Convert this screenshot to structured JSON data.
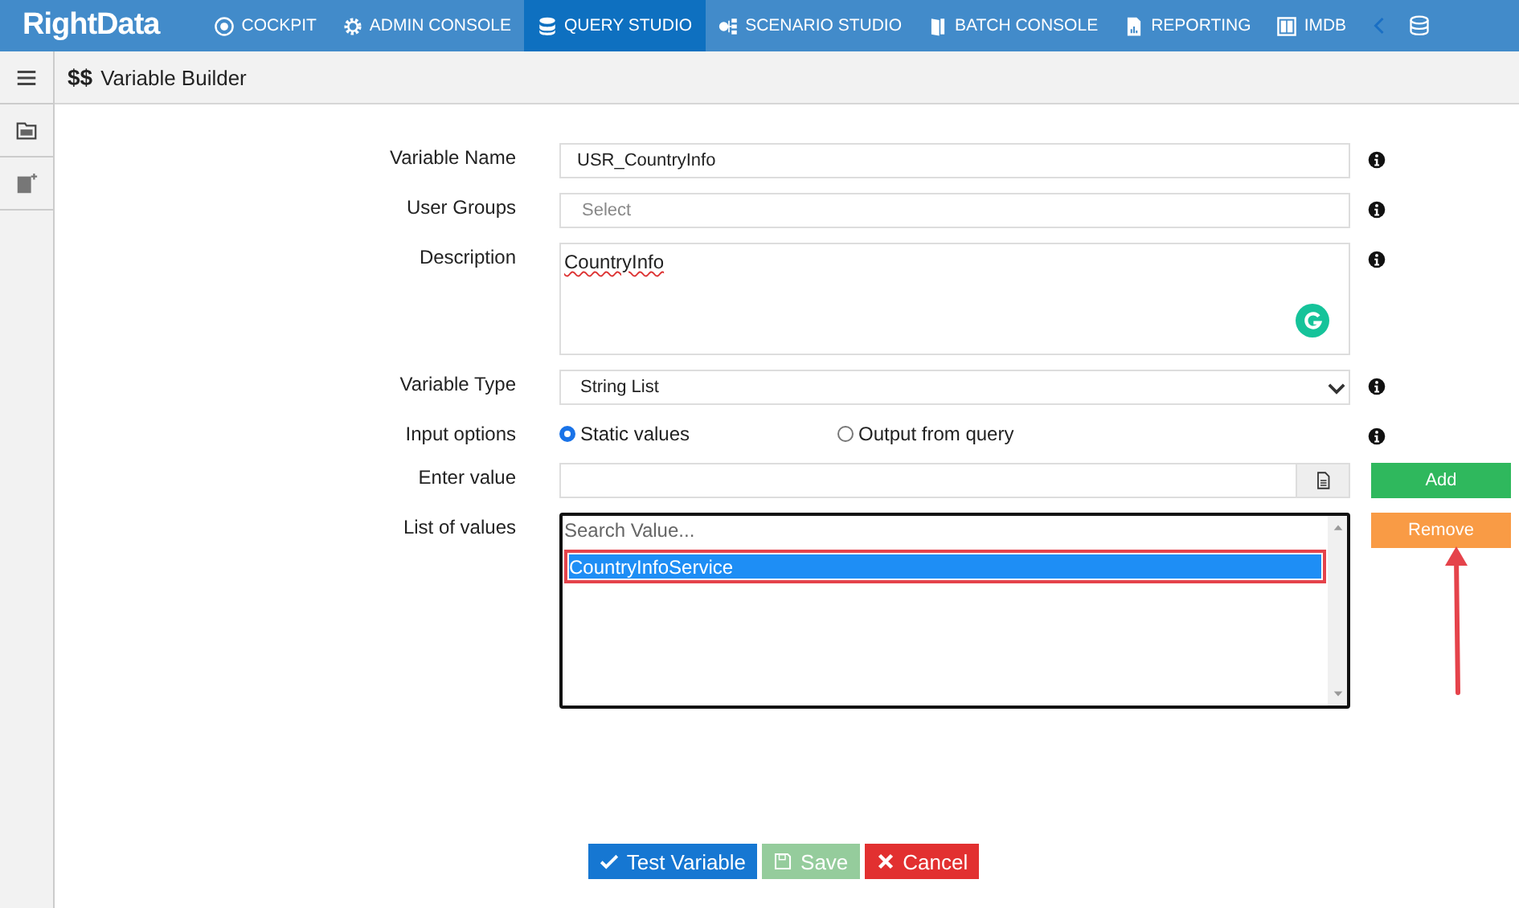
{
  "app": {
    "logo": "RightData"
  },
  "nav": [
    {
      "label": "COCKPIT",
      "selected": false
    },
    {
      "label": "ADMIN CONSOLE",
      "selected": false
    },
    {
      "label": "QUERY STUDIO",
      "selected": true
    },
    {
      "label": "SCENARIO STUDIO",
      "selected": false
    },
    {
      "label": "BATCH CONSOLE",
      "selected": false
    },
    {
      "label": "REPORTING",
      "selected": false
    },
    {
      "label": "IMDB",
      "selected": false
    }
  ],
  "page": {
    "symbol": "$$",
    "title": "Variable Builder"
  },
  "form": [
    {
      "kind": "text",
      "label": "Variable Name",
      "value": "USR_CountryInfo",
      "info": true
    },
    {
      "kind": "text",
      "label": "User Groups",
      "placeholder": "Select",
      "info": true
    },
    {
      "kind": "textarea",
      "label": "Description",
      "value": "CountryInfo",
      "info": true
    },
    {
      "kind": "dropdown",
      "label": "Variable Type",
      "value": "String List",
      "info": true
    },
    {
      "kind": "radio",
      "label": "Input options",
      "options": [
        {
          "label": "Static values",
          "selected": true
        },
        {
          "label": "Output from query",
          "selected": false
        }
      ],
      "info": true
    },
    {
      "kind": "entry",
      "label": "Enter value",
      "button": "Add",
      "info": false
    },
    {
      "kind": "list",
      "label": "List of values",
      "placeholder": "Search Value...",
      "button": "Remove",
      "items": [
        {
          "label": "CountryInfoService",
          "selected": true,
          "highlighted": true
        }
      ],
      "info": false
    }
  ],
  "actions": [
    {
      "label": "Test Variable",
      "kind": "test",
      "disabled": false
    },
    {
      "label": "Save",
      "kind": "save",
      "disabled": true
    },
    {
      "label": "Cancel",
      "kind": "cancel",
      "disabled": false
    }
  ]
}
